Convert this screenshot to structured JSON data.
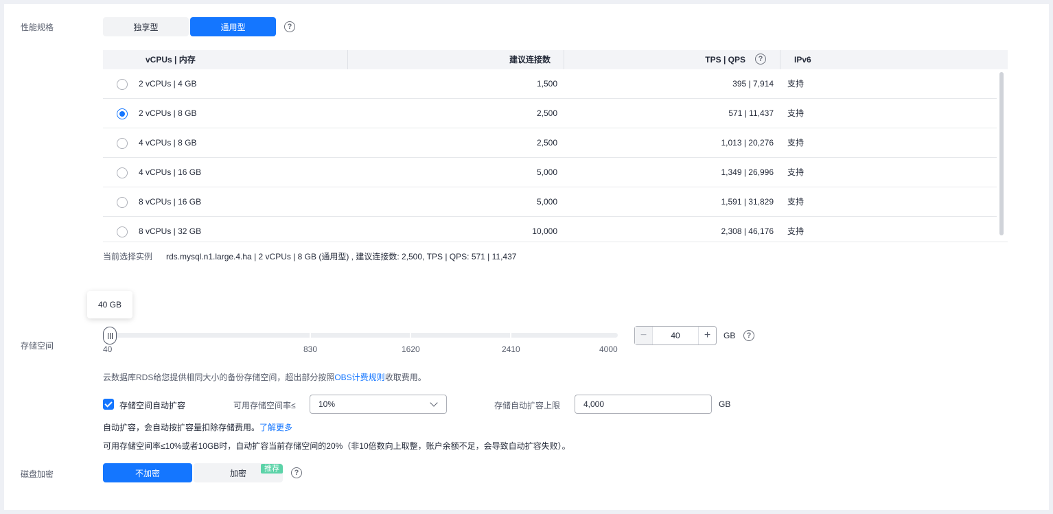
{
  "spec": {
    "label": "性能规格",
    "options": [
      "独享型",
      "通用型"
    ],
    "selected": "通用型",
    "help_icon": "question-circle-icon"
  },
  "table": {
    "headers": {
      "cpu_mem": "vCPUs | 内存",
      "connections": "建议连接数",
      "tps_qps": "TPS | QPS",
      "ipv6": "IPv6"
    },
    "rows": [
      {
        "cpu_mem": "2 vCPUs | 4 GB",
        "connections": "1,500",
        "tps_qps": "395 | 7,914",
        "ipv6": "支持",
        "selected": false
      },
      {
        "cpu_mem": "2 vCPUs | 8 GB",
        "connections": "2,500",
        "tps_qps": "571 | 11,437",
        "ipv6": "支持",
        "selected": true
      },
      {
        "cpu_mem": "4 vCPUs | 8 GB",
        "connections": "2,500",
        "tps_qps": "1,013 | 20,276",
        "ipv6": "支持",
        "selected": false
      },
      {
        "cpu_mem": "4 vCPUs | 16 GB",
        "connections": "5,000",
        "tps_qps": "1,349 | 26,996",
        "ipv6": "支持",
        "selected": false
      },
      {
        "cpu_mem": "8 vCPUs | 16 GB",
        "connections": "5,000",
        "tps_qps": "1,591 | 31,829",
        "ipv6": "支持",
        "selected": false
      },
      {
        "cpu_mem": "8 vCPUs | 32 GB",
        "connections": "10,000",
        "tps_qps": "2,308 | 46,176",
        "ipv6": "支持",
        "selected": false
      }
    ]
  },
  "current": {
    "label": "当前选择实例",
    "value": "rds.mysql.n1.large.4.ha | 2 vCPUs | 8 GB (通用型) , 建议连接数: 2,500, TPS | QPS: 571 | 11,437"
  },
  "storage": {
    "label": "存储空间",
    "tooltip": "40 GB",
    "scale": [
      "40",
      "830",
      "1620",
      "2410",
      "4000"
    ],
    "value": "40",
    "unit": "GB",
    "note_prefix": "云数据库RDS给您提供相同大小的备份存储空间，超出部分按照",
    "note_link": "OBS计费规则",
    "note_suffix": "收取费用。"
  },
  "autoscale": {
    "checkbox_label": "存储空间自动扩容",
    "checked": true,
    "threshold_label": "可用存储空间率≤",
    "threshold_value": "10%",
    "limit_label": "存储自动扩容上限",
    "limit_value": "4,000",
    "limit_unit": "GB",
    "desc1": "自动扩容，会自动按扩容量扣除存储费用。",
    "desc1_link": "了解更多",
    "desc2": "可用存储空间率≤10%或者10GB时，自动扩容当前存储空间的20%（非10倍数向上取整，账户余额不足，会导致自动扩容失败）。"
  },
  "encryption": {
    "label": "磁盘加密",
    "options": [
      "不加密",
      "加密"
    ],
    "selected": "不加密",
    "badge": "推荐"
  }
}
